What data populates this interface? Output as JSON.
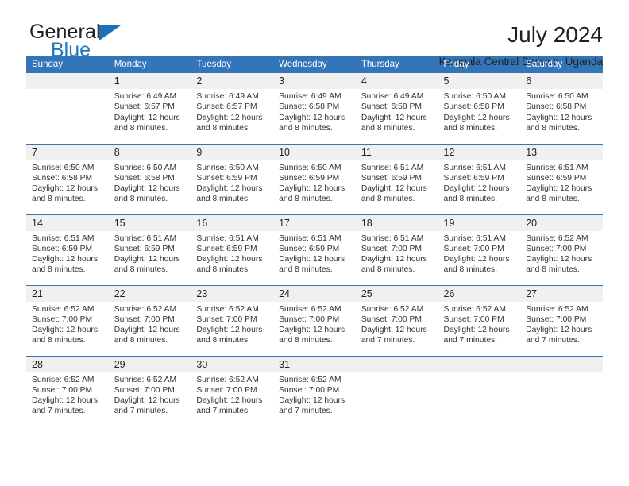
{
  "brand": {
    "name_part1": "General",
    "name_part2": "Blue",
    "triangle_color": "#1d6fb8",
    "blue_color": "#2175bc"
  },
  "header": {
    "title": "July 2024",
    "subtitle": "Kampala Central Division, Uganda"
  },
  "calendar": {
    "header_bg": "#3275b8",
    "daynum_bg": "#f0f0f0",
    "weekday_labels": [
      "Sunday",
      "Monday",
      "Tuesday",
      "Wednesday",
      "Thursday",
      "Friday",
      "Saturday"
    ],
    "weeks": [
      [
        {
          "day": "",
          "sunrise": "",
          "sunset": "",
          "daylight1": "",
          "daylight2": ""
        },
        {
          "day": "1",
          "sunrise": "Sunrise: 6:49 AM",
          "sunset": "Sunset: 6:57 PM",
          "daylight1": "Daylight: 12 hours",
          "daylight2": "and 8 minutes."
        },
        {
          "day": "2",
          "sunrise": "Sunrise: 6:49 AM",
          "sunset": "Sunset: 6:57 PM",
          "daylight1": "Daylight: 12 hours",
          "daylight2": "and 8 minutes."
        },
        {
          "day": "3",
          "sunrise": "Sunrise: 6:49 AM",
          "sunset": "Sunset: 6:58 PM",
          "daylight1": "Daylight: 12 hours",
          "daylight2": "and 8 minutes."
        },
        {
          "day": "4",
          "sunrise": "Sunrise: 6:49 AM",
          "sunset": "Sunset: 6:58 PM",
          "daylight1": "Daylight: 12 hours",
          "daylight2": "and 8 minutes."
        },
        {
          "day": "5",
          "sunrise": "Sunrise: 6:50 AM",
          "sunset": "Sunset: 6:58 PM",
          "daylight1": "Daylight: 12 hours",
          "daylight2": "and 8 minutes."
        },
        {
          "day": "6",
          "sunrise": "Sunrise: 6:50 AM",
          "sunset": "Sunset: 6:58 PM",
          "daylight1": "Daylight: 12 hours",
          "daylight2": "and 8 minutes."
        }
      ],
      [
        {
          "day": "7",
          "sunrise": "Sunrise: 6:50 AM",
          "sunset": "Sunset: 6:58 PM",
          "daylight1": "Daylight: 12 hours",
          "daylight2": "and 8 minutes."
        },
        {
          "day": "8",
          "sunrise": "Sunrise: 6:50 AM",
          "sunset": "Sunset: 6:58 PM",
          "daylight1": "Daylight: 12 hours",
          "daylight2": "and 8 minutes."
        },
        {
          "day": "9",
          "sunrise": "Sunrise: 6:50 AM",
          "sunset": "Sunset: 6:59 PM",
          "daylight1": "Daylight: 12 hours",
          "daylight2": "and 8 minutes."
        },
        {
          "day": "10",
          "sunrise": "Sunrise: 6:50 AM",
          "sunset": "Sunset: 6:59 PM",
          "daylight1": "Daylight: 12 hours",
          "daylight2": "and 8 minutes."
        },
        {
          "day": "11",
          "sunrise": "Sunrise: 6:51 AM",
          "sunset": "Sunset: 6:59 PM",
          "daylight1": "Daylight: 12 hours",
          "daylight2": "and 8 minutes."
        },
        {
          "day": "12",
          "sunrise": "Sunrise: 6:51 AM",
          "sunset": "Sunset: 6:59 PM",
          "daylight1": "Daylight: 12 hours",
          "daylight2": "and 8 minutes."
        },
        {
          "day": "13",
          "sunrise": "Sunrise: 6:51 AM",
          "sunset": "Sunset: 6:59 PM",
          "daylight1": "Daylight: 12 hours",
          "daylight2": "and 8 minutes."
        }
      ],
      [
        {
          "day": "14",
          "sunrise": "Sunrise: 6:51 AM",
          "sunset": "Sunset: 6:59 PM",
          "daylight1": "Daylight: 12 hours",
          "daylight2": "and 8 minutes."
        },
        {
          "day": "15",
          "sunrise": "Sunrise: 6:51 AM",
          "sunset": "Sunset: 6:59 PM",
          "daylight1": "Daylight: 12 hours",
          "daylight2": "and 8 minutes."
        },
        {
          "day": "16",
          "sunrise": "Sunrise: 6:51 AM",
          "sunset": "Sunset: 6:59 PM",
          "daylight1": "Daylight: 12 hours",
          "daylight2": "and 8 minutes."
        },
        {
          "day": "17",
          "sunrise": "Sunrise: 6:51 AM",
          "sunset": "Sunset: 6:59 PM",
          "daylight1": "Daylight: 12 hours",
          "daylight2": "and 8 minutes."
        },
        {
          "day": "18",
          "sunrise": "Sunrise: 6:51 AM",
          "sunset": "Sunset: 7:00 PM",
          "daylight1": "Daylight: 12 hours",
          "daylight2": "and 8 minutes."
        },
        {
          "day": "19",
          "sunrise": "Sunrise: 6:51 AM",
          "sunset": "Sunset: 7:00 PM",
          "daylight1": "Daylight: 12 hours",
          "daylight2": "and 8 minutes."
        },
        {
          "day": "20",
          "sunrise": "Sunrise: 6:52 AM",
          "sunset": "Sunset: 7:00 PM",
          "daylight1": "Daylight: 12 hours",
          "daylight2": "and 8 minutes."
        }
      ],
      [
        {
          "day": "21",
          "sunrise": "Sunrise: 6:52 AM",
          "sunset": "Sunset: 7:00 PM",
          "daylight1": "Daylight: 12 hours",
          "daylight2": "and 8 minutes."
        },
        {
          "day": "22",
          "sunrise": "Sunrise: 6:52 AM",
          "sunset": "Sunset: 7:00 PM",
          "daylight1": "Daylight: 12 hours",
          "daylight2": "and 8 minutes."
        },
        {
          "day": "23",
          "sunrise": "Sunrise: 6:52 AM",
          "sunset": "Sunset: 7:00 PM",
          "daylight1": "Daylight: 12 hours",
          "daylight2": "and 8 minutes."
        },
        {
          "day": "24",
          "sunrise": "Sunrise: 6:52 AM",
          "sunset": "Sunset: 7:00 PM",
          "daylight1": "Daylight: 12 hours",
          "daylight2": "and 8 minutes."
        },
        {
          "day": "25",
          "sunrise": "Sunrise: 6:52 AM",
          "sunset": "Sunset: 7:00 PM",
          "daylight1": "Daylight: 12 hours",
          "daylight2": "and 7 minutes."
        },
        {
          "day": "26",
          "sunrise": "Sunrise: 6:52 AM",
          "sunset": "Sunset: 7:00 PM",
          "daylight1": "Daylight: 12 hours",
          "daylight2": "and 7 minutes."
        },
        {
          "day": "27",
          "sunrise": "Sunrise: 6:52 AM",
          "sunset": "Sunset: 7:00 PM",
          "daylight1": "Daylight: 12 hours",
          "daylight2": "and 7 minutes."
        }
      ],
      [
        {
          "day": "28",
          "sunrise": "Sunrise: 6:52 AM",
          "sunset": "Sunset: 7:00 PM",
          "daylight1": "Daylight: 12 hours",
          "daylight2": "and 7 minutes."
        },
        {
          "day": "29",
          "sunrise": "Sunrise: 6:52 AM",
          "sunset": "Sunset: 7:00 PM",
          "daylight1": "Daylight: 12 hours",
          "daylight2": "and 7 minutes."
        },
        {
          "day": "30",
          "sunrise": "Sunrise: 6:52 AM",
          "sunset": "Sunset: 7:00 PM",
          "daylight1": "Daylight: 12 hours",
          "daylight2": "and 7 minutes."
        },
        {
          "day": "31",
          "sunrise": "Sunrise: 6:52 AM",
          "sunset": "Sunset: 7:00 PM",
          "daylight1": "Daylight: 12 hours",
          "daylight2": "and 7 minutes."
        },
        {
          "day": "",
          "sunrise": "",
          "sunset": "",
          "daylight1": "",
          "daylight2": ""
        },
        {
          "day": "",
          "sunrise": "",
          "sunset": "",
          "daylight1": "",
          "daylight2": ""
        },
        {
          "day": "",
          "sunrise": "",
          "sunset": "",
          "daylight1": "",
          "daylight2": ""
        }
      ]
    ]
  }
}
